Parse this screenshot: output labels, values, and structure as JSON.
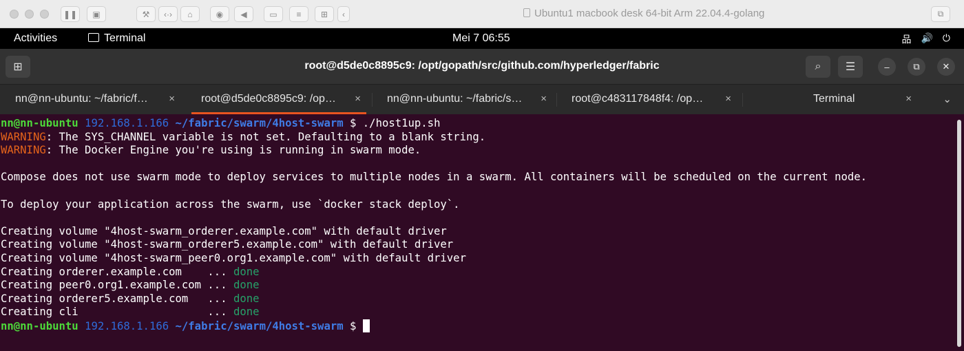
{
  "vm_window": {
    "title": "Ubuntu1 macbook desk 64-bit Arm 22.04.4-golang"
  },
  "top_bar": {
    "activities": "Activities",
    "app_name": "Terminal",
    "clock": "Mei 7  06:55"
  },
  "terminal": {
    "header_title": "root@d5de0c8895c9: /opt/gopath/src/github.com/hyperledger/fabric",
    "tabs": [
      {
        "label": "nn@nn-ubuntu: ~/fabric/f…",
        "close": "×"
      },
      {
        "label": "root@d5de0c8895c9: /op…",
        "close": "×"
      },
      {
        "label": "nn@nn-ubuntu: ~/fabric/s…",
        "close": "×"
      },
      {
        "label": "root@c483117848f4: /op…",
        "close": "×"
      },
      {
        "label": "Terminal",
        "close": "×"
      }
    ],
    "tab_menu": "⌄",
    "prompt": {
      "user": "nn@nn-ubuntu",
      "ip": "192.168.1.166",
      "path": "~/fabric/swarm/4host-swarm",
      "symbol": "$"
    },
    "lines": {
      "cmd": "./host1up.sh",
      "warn_label": "WARNING",
      "warn1": ": The SYS_CHANNEL variable is not set. Defaulting to a blank string.",
      "warn2": ": The Docker Engine you're using is running in swarm mode.",
      "compose": "Compose does not use swarm mode to deploy services to multiple nodes in a swarm. All containers will be scheduled on the current node.",
      "deploy": "To deploy your application across the swarm, use `docker stack deploy`.",
      "vol1": "Creating volume \"4host-swarm_orderer.example.com\" with default driver",
      "vol2": "Creating volume \"4host-swarm_orderer5.example.com\" with default driver",
      "vol3": "Creating volume \"4host-swarm_peer0.org1.example.com\" with default driver",
      "c1": "Creating orderer.example.com    ... ",
      "c2": "Creating peer0.org1.example.com ... ",
      "c3": "Creating orderer5.example.com   ... ",
      "c4": "Creating cli                    ... ",
      "done": "done"
    }
  },
  "colors": {
    "terminal_bg": "#300a24",
    "prompt_user": "#4dd93a",
    "prompt_path": "#3f7ce6",
    "warning": "#e6641a",
    "done": "#26a269",
    "tab_accent": "#e95420"
  }
}
